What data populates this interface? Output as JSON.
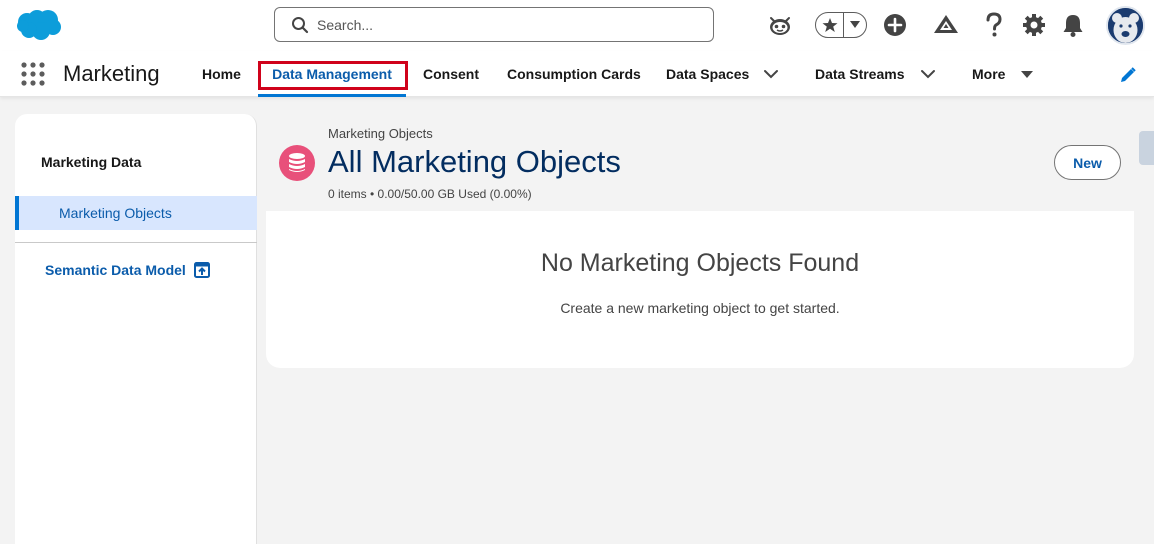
{
  "header": {
    "search_placeholder": "Search...",
    "icons": [
      "salesforce-cloud-logo",
      "search-icon",
      "assistant-face-icon",
      "favorites-star-icon",
      "favorites-caret-icon",
      "global-add-icon",
      "trailhead-guidance-icon",
      "help-icon",
      "setup-gear-icon",
      "notifications-bell-icon",
      "user-avatar"
    ]
  },
  "app_nav": {
    "app_name": "Marketing",
    "items": [
      {
        "label": "Home"
      },
      {
        "label": "Data Management",
        "active": true
      },
      {
        "label": "Consent"
      },
      {
        "label": "Consumption Cards"
      },
      {
        "label": "Data Spaces"
      },
      {
        "label": "Data Streams"
      },
      {
        "label": "More"
      }
    ]
  },
  "sidebar": {
    "heading": "Marketing Data",
    "selected_item": "Marketing Objects",
    "link": "Semantic Data Model"
  },
  "page": {
    "breadcrumb": "Marketing Objects",
    "title": "All Marketing Objects",
    "meta": "0 items • 0.00/50.00 GB Used (0.00%)",
    "new_button": "New"
  },
  "empty_state": {
    "title": "No Marketing Objects Found",
    "subtitle": "Create a new marketing object to get started."
  },
  "colors": {
    "brand_blue": "#0176d3",
    "link_blue": "#0b5cab",
    "title_navy": "#032d60",
    "object_icon_pink": "#e8507a",
    "highlight_red": "#d0021b",
    "background": "#f3f3f3"
  }
}
